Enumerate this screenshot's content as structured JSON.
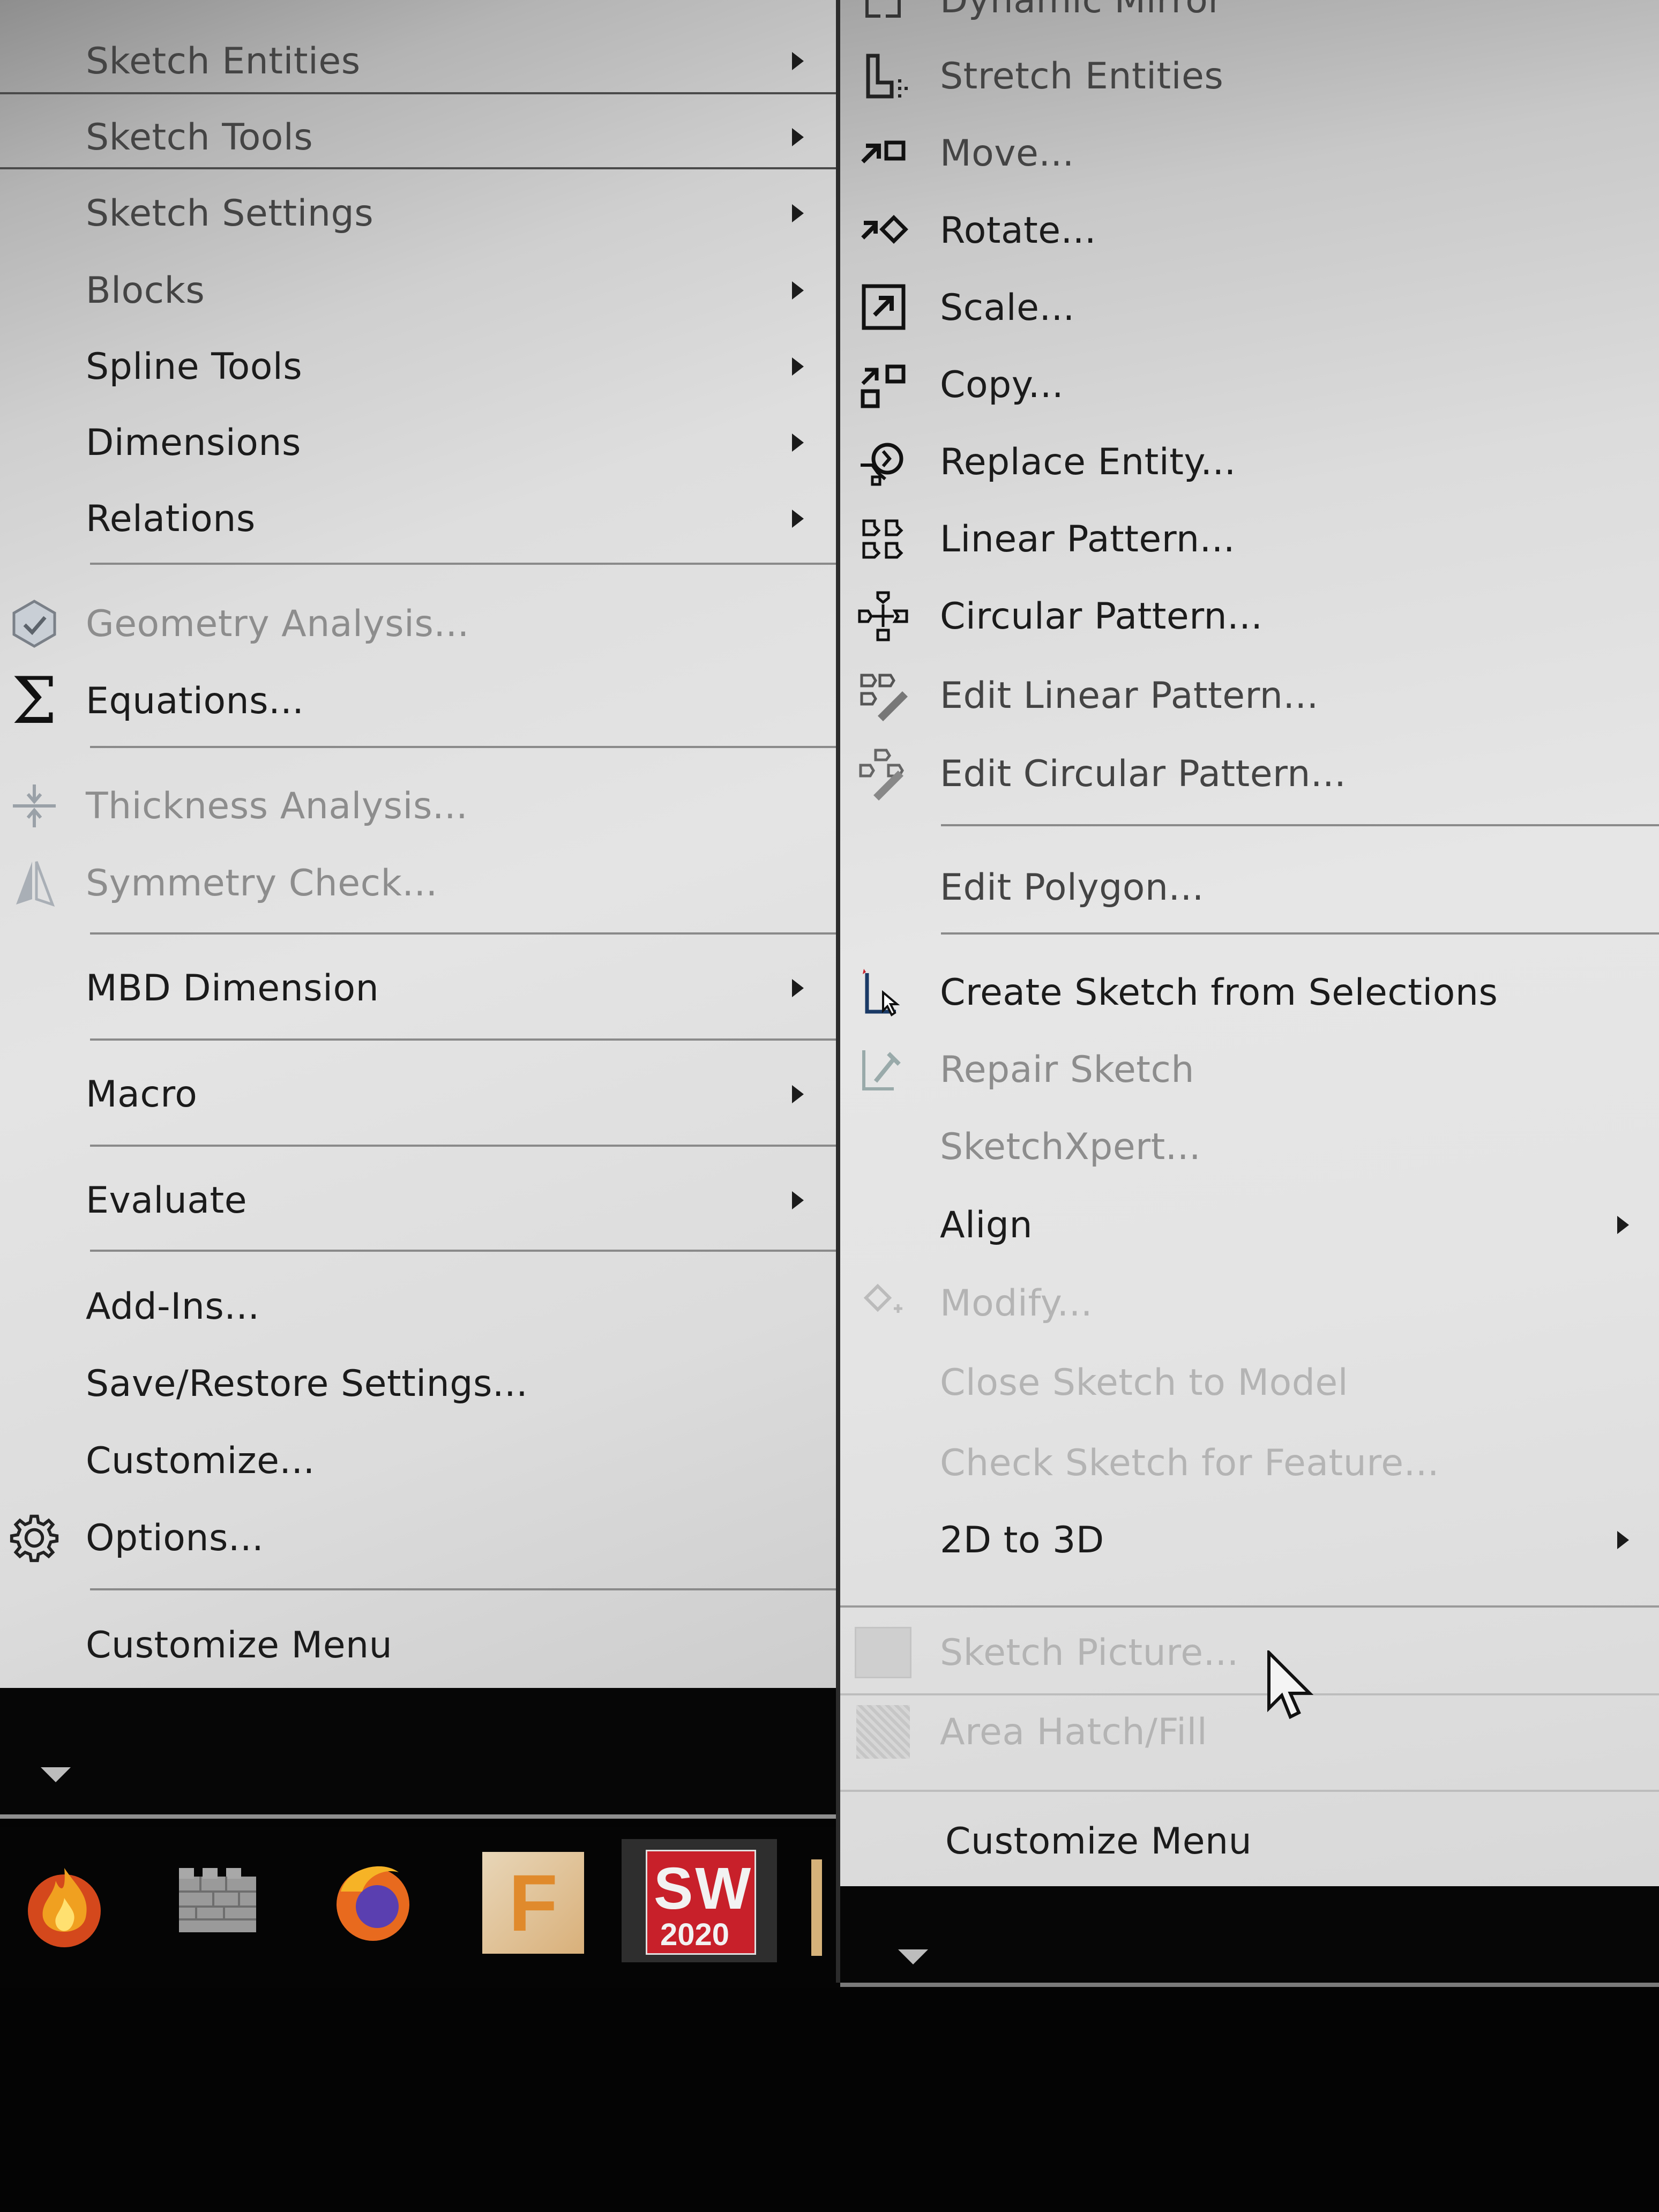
{
  "left_menu": {
    "items": [
      {
        "label": "Sketch Entities"
      },
      {
        "label": "Sketch Tools"
      },
      {
        "label": "Sketch Settings"
      },
      {
        "label": "Blocks"
      },
      {
        "label": "Spline Tools"
      },
      {
        "label": "Dimensions"
      },
      {
        "label": "Relations"
      },
      {
        "label": "Geometry Analysis..."
      },
      {
        "label": "Equations..."
      },
      {
        "label": "Thickness Analysis..."
      },
      {
        "label": "Symmetry Check..."
      },
      {
        "label": "MBD Dimension"
      },
      {
        "label": "Macro"
      },
      {
        "label": "Evaluate"
      },
      {
        "label": "Add-Ins..."
      },
      {
        "label": "Save/Restore Settings..."
      },
      {
        "label": "Customize..."
      },
      {
        "label": "Options..."
      },
      {
        "label": "Customize Menu"
      }
    ]
  },
  "right_menu": {
    "items": [
      {
        "label": "Dynamic Mirror"
      },
      {
        "label": "Stretch Entities"
      },
      {
        "label": "Move..."
      },
      {
        "label": "Rotate..."
      },
      {
        "label": "Scale..."
      },
      {
        "label": "Copy..."
      },
      {
        "label": "Replace Entity..."
      },
      {
        "label": "Linear Pattern..."
      },
      {
        "label": "Circular Pattern..."
      },
      {
        "label": "Edit Linear Pattern..."
      },
      {
        "label": "Edit Circular Pattern..."
      },
      {
        "label": "Edit Polygon..."
      },
      {
        "label": "Create Sketch from Selections"
      },
      {
        "label": "Repair Sketch"
      },
      {
        "label": "SketchXpert..."
      },
      {
        "label": "Align"
      },
      {
        "label": "Modify..."
      },
      {
        "label": "Close Sketch to Model"
      },
      {
        "label": "Check Sketch for Feature..."
      },
      {
        "label": "2D to 3D"
      },
      {
        "label": "Sketch Picture..."
      },
      {
        "label": "Area Hatch/Fill"
      },
      {
        "label": "Customize Menu"
      }
    ]
  },
  "taskbar": {
    "solidworks_label": "SW",
    "solidworks_version": "2020",
    "fusion_label": "F"
  },
  "colors": {
    "menu_bg": "#dcdcdc",
    "text": "#1b1b1b",
    "disabled_text": "#8d8d8d",
    "taskbar_bg": "#050505",
    "solidworks_red": "#c8202a"
  }
}
